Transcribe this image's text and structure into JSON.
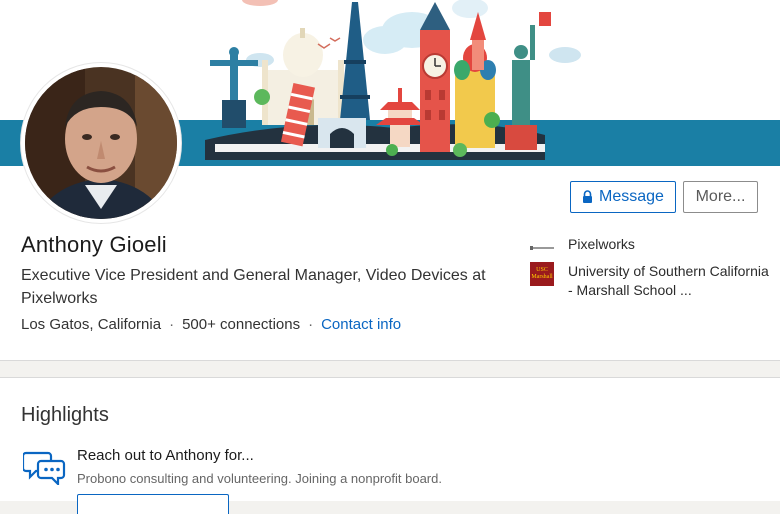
{
  "profile": {
    "name": "Anthony Gioeli",
    "headline": "Executive Vice President and General Manager, Video Devices at Pixelworks",
    "location": "Los Gatos, California",
    "separator": "·",
    "connections": "500+ connections",
    "contact_info": "Contact info"
  },
  "actions": {
    "message_label": "Message",
    "more_label": "More..."
  },
  "organizations": [
    {
      "name": "Pixelworks",
      "logo_text": "pixelworks"
    },
    {
      "name": "University of Southern California - Marshall School ...",
      "logo_text": "USC Marshall"
    }
  ],
  "highlights": {
    "title": "Highlights",
    "heading": "Reach out to Anthony for...",
    "subtext": "Probono consulting and volunteering. Joining a nonprofit board."
  },
  "colors": {
    "link_blue": "#0a66c2",
    "banner_teal": "#1a7fa5",
    "usc_red": "#9a1a1d"
  }
}
